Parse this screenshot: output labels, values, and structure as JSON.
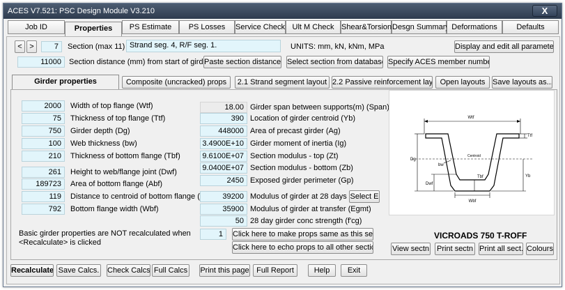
{
  "window": {
    "title": "ACES V7.521: PSC Design Module V3.210",
    "close": "X"
  },
  "tabs": [
    "Job ID",
    "Properties",
    "PS Estimate",
    "PS Losses",
    "Service Check",
    "Ult M Check",
    "Shear&Torsion",
    "Desgn Summary",
    "Deformations",
    "Defaults"
  ],
  "section": {
    "prev": "<",
    "next": ">",
    "number": "7",
    "label": "Section (max 11)",
    "description": "Strand seg.  4, R/F seg.  1.",
    "units": "UNITS: mm, kN, kNm, MPa",
    "display_all_button": "Display and edit all parameters",
    "distance_value": "11000",
    "distance_label": "Section distance (mm) from start of girder (x)",
    "paste_button": "Paste section distances",
    "select_db_button": "Select section from database",
    "specify_button": "Specify ACES member numbers"
  },
  "subtabs": [
    "Girder properties",
    "Composite (uncracked) props",
    "2.1 Strand segment layout",
    "2.2 Passive reinforcement layout",
    "Open layouts",
    "Save layouts as..."
  ],
  "left_props": [
    {
      "value": "2000",
      "label": "Width of top flange (Wtf)"
    },
    {
      "value": "75",
      "label": "Thickness of top flange (Ttf)"
    },
    {
      "value": "750",
      "label": "Girder depth (Dg)"
    },
    {
      "value": "100",
      "label": "Web thickness (bw)"
    },
    {
      "value": "210",
      "label": "Thickness of bottom flange (Tbf)"
    },
    {
      "value": "261",
      "label": "Height to web/flange joint (Dwf)"
    },
    {
      "value": "189723",
      "label": "Area of bottom flange (Abf)"
    },
    {
      "value": "119",
      "label": "Distance to centroid of bottom flange (Ybf)"
    },
    {
      "value": "792",
      "label": "Bottom flange width (Wbf)"
    }
  ],
  "right_props": [
    {
      "value": "18.00",
      "label": "Girder span between supports(m) (Span)"
    },
    {
      "value": "390",
      "label": "Location of girder centroid (Yb)"
    },
    {
      "value": "448000",
      "label": "Area of precast girder (Ag)"
    },
    {
      "value": "3.4900E+10",
      "label": "Girder moment of inertia (Ig)"
    },
    {
      "value": "9.6100E+07",
      "label": "Section modulus - top (Zt)"
    },
    {
      "value": "9.0400E+07",
      "label": "Section modulus - bottom (Zb)"
    },
    {
      "value": "2450",
      "label": "Exposed girder perimeter (Gp)"
    },
    {
      "value": "39200",
      "label": "Modulus of girder at 28 days (Eg)"
    },
    {
      "value": "35900",
      "label": "Modulus of girder at transfer (Egmt)"
    },
    {
      "value": "50",
      "label": "28 day girder conc strength (f'cg)"
    }
  ],
  "select_e_button": "Select E",
  "note_line1": "Basic girder properties are NOT recalculated when",
  "note_line2": "<Recalculate> is clicked",
  "same_section_value": "1",
  "make_same_button": "Click here to make props same as this section",
  "echo_button": "Click here to echo props to all other sections",
  "diagram": {
    "caption": "VICROADS 750 T-ROFF",
    "labels": {
      "wtf": "Wtf",
      "ttf": "Ttf",
      "dg": "Dg",
      "bw": "bw",
      "centroid": "Centroid",
      "yb": "Yb",
      "dwf": "Dwf",
      "tbf": "Tbf",
      "wbf": "Wbf"
    }
  },
  "diagram_buttons": [
    "View sectn",
    "Print sectn",
    "Print all sect.",
    "Colours"
  ],
  "bottom_buttons": [
    "Recalculate",
    "Save Calcs.",
    "Check Calcs",
    "Full Calcs",
    "Print this page",
    "Full Report",
    "Help",
    "Exit"
  ]
}
